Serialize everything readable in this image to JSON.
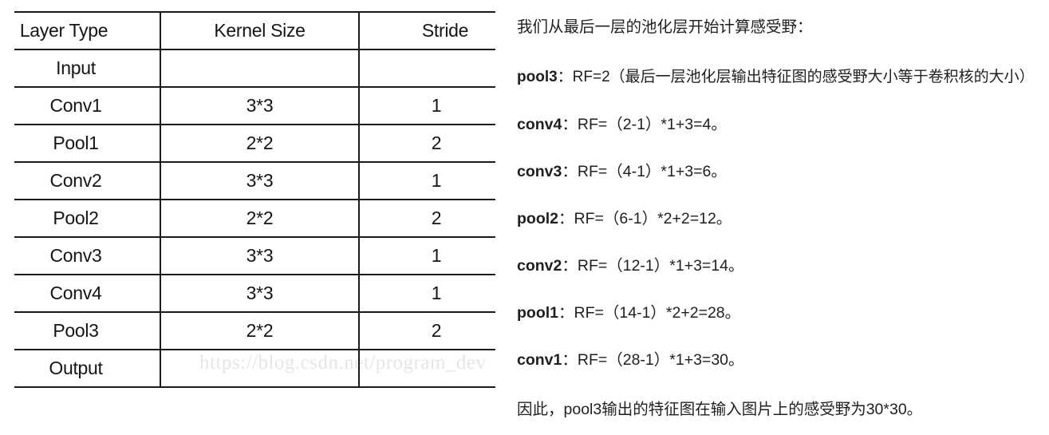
{
  "table": {
    "headers": [
      "Layer Type",
      "Kernel Size",
      "Stride"
    ],
    "rows": [
      {
        "layer": "Input",
        "kernel": "",
        "stride": ""
      },
      {
        "layer": "Conv1",
        "kernel": "3*3",
        "stride": "1"
      },
      {
        "layer": "Pool1",
        "kernel": "2*2",
        "stride": "2"
      },
      {
        "layer": "Conv2",
        "kernel": "3*3",
        "stride": "1"
      },
      {
        "layer": "Pool2",
        "kernel": "2*2",
        "stride": "2"
      },
      {
        "layer": "Conv3",
        "kernel": "3*3",
        "stride": "1"
      },
      {
        "layer": "Conv4",
        "kernel": "3*3",
        "stride": "1"
      },
      {
        "layer": "Pool3",
        "kernel": "2*2",
        "stride": "2"
      },
      {
        "layer": "Output",
        "kernel": "",
        "stride": ""
      }
    ]
  },
  "watermark": {
    "text": "https://blog.csdn.net/program_dev"
  },
  "explanation": {
    "intro": "我们从最后一层的池化层开始计算感受野：",
    "steps": [
      {
        "label": "pool3",
        "formula": "：RF=2（最后一层池化层输出特征图的感受野大小等于卷积核的大小）"
      },
      {
        "label": "conv4",
        "formula": "：RF=（2-1）*1+3=4。"
      },
      {
        "label": "conv3",
        "formula": "：RF=（4-1）*1+3=6。"
      },
      {
        "label": "pool2",
        "formula": "：RF=（6-1）*2+2=12。"
      },
      {
        "label": "conv2",
        "formula": "：RF=（12-1）*1+3=14。"
      },
      {
        "label": "pool1",
        "formula": "：RF=（14-1）*2+2=28。"
      },
      {
        "label": "conv1",
        "formula": "：RF=（28-1）*1+3=30。"
      }
    ],
    "conclusion": "因此，pool3输出的特征图在输入图片上的感受野为30*30。"
  },
  "colors": {
    "text": "#1f1f1f",
    "border": "#1b1b1b",
    "watermark": "#e6e6e6",
    "background": "#ffffff"
  }
}
